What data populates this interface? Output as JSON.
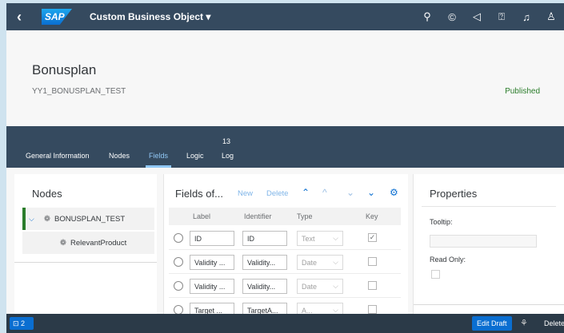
{
  "shell": {
    "logo": "SAP",
    "title": "Custom Business Object",
    "icons": [
      "search-icon",
      "copilot-icon",
      "notifications-megaphone-icon",
      "help-icon",
      "bell-icon",
      "user-icon"
    ]
  },
  "header": {
    "title": "Bonusplan",
    "identifier": "YY1_BONUSPLAN_TEST",
    "status": "Published",
    "status_color": "#2b7d2b"
  },
  "tabs": [
    {
      "label": "General Information",
      "active": false
    },
    {
      "label": "Nodes",
      "active": false
    },
    {
      "label": "Fields",
      "active": true
    },
    {
      "label": "Logic",
      "active": false
    },
    {
      "label": "Log",
      "active": false,
      "count": "13"
    }
  ],
  "nodes": {
    "title": "Nodes",
    "items": [
      {
        "label": "BONUSPLAN_TEST",
        "level": 0,
        "expanded": true,
        "selected": true
      },
      {
        "label": "RelevantProduct",
        "level": 1
      }
    ]
  },
  "fields": {
    "title": "Fields of...",
    "new_label": "New",
    "delete_label": "Delete",
    "columns": [
      "Label",
      "Identifier",
      "Type",
      "Key"
    ],
    "rows": [
      {
        "label": "ID",
        "identifier": "ID",
        "type": "Text",
        "key": true
      },
      {
        "label": "Validity ...",
        "identifier": "Validity...",
        "type": "Date",
        "key": false
      },
      {
        "label": "Validity ...",
        "identifier": "Validity...",
        "type": "Date",
        "key": false
      },
      {
        "label": "Target ...",
        "identifier": "TargetA...",
        "type": "A...",
        "key": false
      }
    ]
  },
  "properties": {
    "title": "Properties",
    "tooltip_label": "Tooltip:",
    "tooltip_value": "",
    "readonly_label": "Read Only:"
  },
  "footer": {
    "messages_count": "2",
    "edit_draft_label": "Edit Draft",
    "delete_label": "Delete"
  },
  "colors": {
    "shell": "#354a5f",
    "accent": "#0a6ed1",
    "active_tab": "#91c8f6"
  }
}
